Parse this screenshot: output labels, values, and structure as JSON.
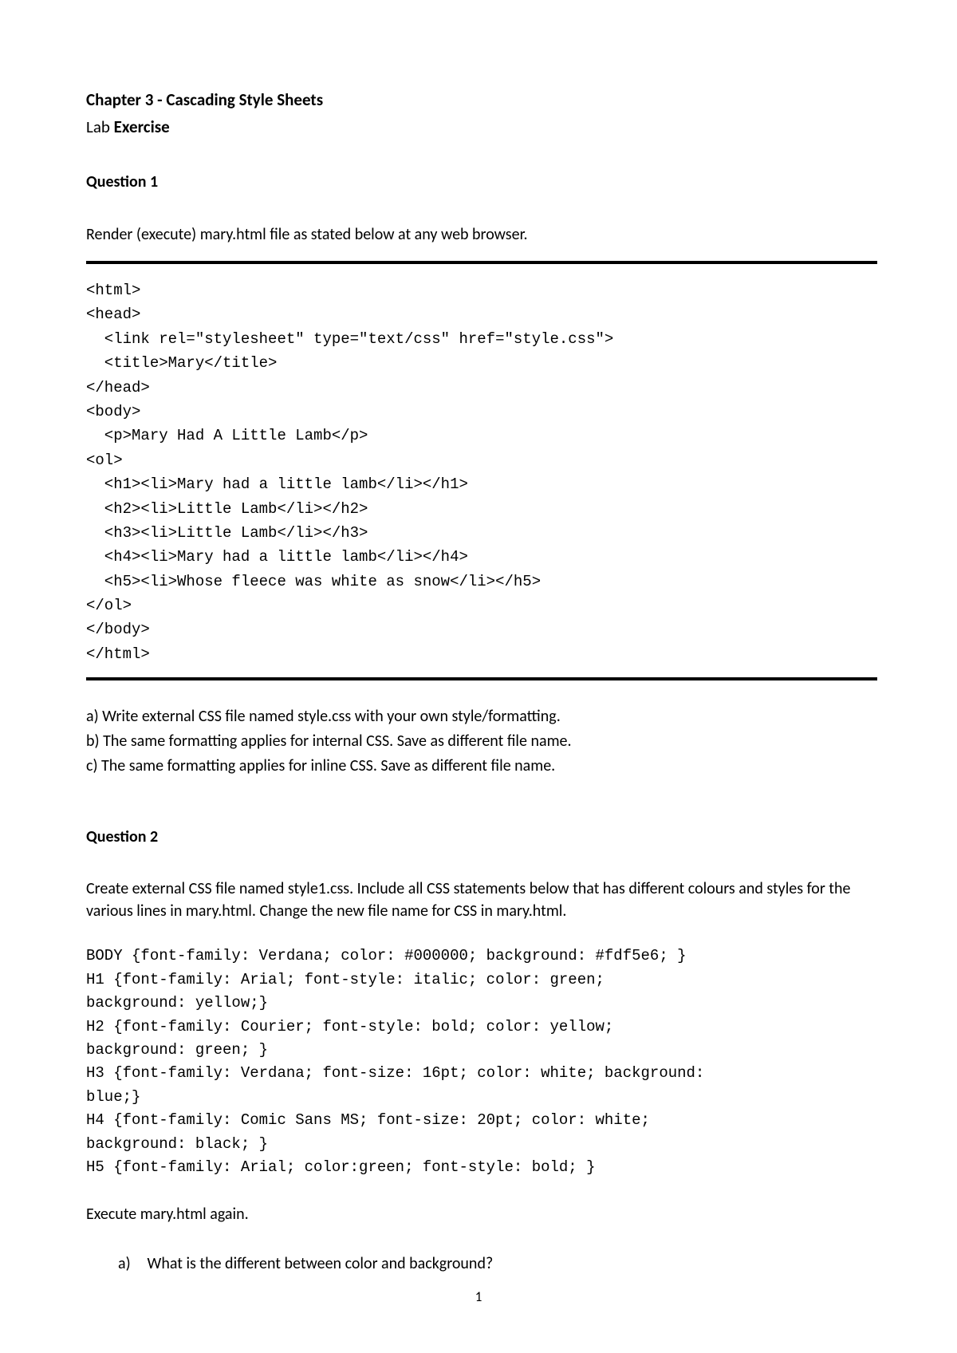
{
  "header": {
    "chapter_title": "Chapter 3 - Cascading Style Sheets",
    "lab_prefix": "Lab ",
    "lab_bold": "Exercise"
  },
  "q1": {
    "heading": "Question 1",
    "intro": "Render (execute) mary.html file as stated below at any web browser.",
    "code": "<html>\n<head>\n  <link rel=\"stylesheet\" type=\"text/css\" href=\"style.css\">\n  <title>Mary</title>\n</head>\n<body>\n  <p>Mary Had A Little Lamb</p>\n<ol>\n  <h1><li>Mary had a little lamb</li></h1>\n  <h2><li>Little Lamb</li></h2>\n  <h3><li>Little Lamb</li></h3>\n  <h4><li>Mary had a little lamb</li></h4>\n  <h5><li>Whose fleece was white as snow</li></h5>\n</ol>\n</body>\n</html>",
    "a": "a) Write external CSS file named style.css with your own style/formatting.",
    "b": "b) The same formatting applies for internal CSS. Save as different file name.",
    "c": "c) The same formatting applies for inline CSS. Save as different file name."
  },
  "q2": {
    "heading": "Question 2",
    "intro": "Create external CSS file named style1.css. Include all CSS statements below that has different colours and styles for the various lines in mary.html. Change the new file name for CSS in mary.html.",
    "code": "BODY {font-family: Verdana; color: #000000; background: #fdf5e6; }\nH1 {font-family: Arial; font-style: italic; color: green;\nbackground: yellow;}\nH2 {font-family: Courier; font-style: bold; color: yellow;\nbackground: green; }\nH3 {font-family: Verdana; font-size: 16pt; color: white; background:\nblue;}\nH4 {font-family: Comic Sans MS; font-size: 20pt; color: white;\nbackground: black; }\nH5 {font-family: Arial; color:green; font-style: bold; }",
    "execute": "Execute mary.html again.",
    "sub_a_label": "a)",
    "sub_a_text": "What is the different between color and background?"
  },
  "page_number": "1"
}
